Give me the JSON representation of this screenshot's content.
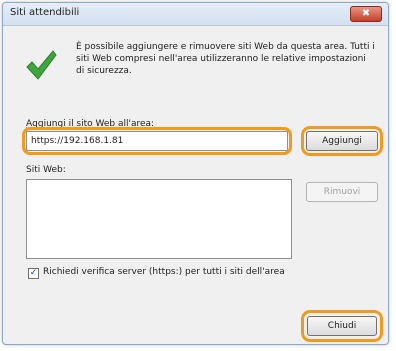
{
  "window": {
    "title": "Siti attendibili",
    "close_glyph": "✖"
  },
  "info": {
    "icon": "checkmark-icon",
    "text": "È possibile aggiungere e rimuovere siti Web da questa area. Tutti i siti Web compresi nell'area utilizzeranno le relative impostazioni di sicurezza."
  },
  "add_site": {
    "label": "Aggiungi il sito Web all'area:",
    "value": "https://192.168.1.81",
    "button_label": "Aggiungi"
  },
  "sites": {
    "label": "Siti Web:",
    "items": [],
    "remove_label": "Rimuovi"
  },
  "https_check": {
    "checked": true,
    "mark": "✓",
    "label": "Richiedi verifica server (https:) per tutti i siti dell'area"
  },
  "footer": {
    "close_label": "Chiudi"
  },
  "colors": {
    "highlight": "#f29a1b",
    "check_green": "#3ea63c"
  }
}
